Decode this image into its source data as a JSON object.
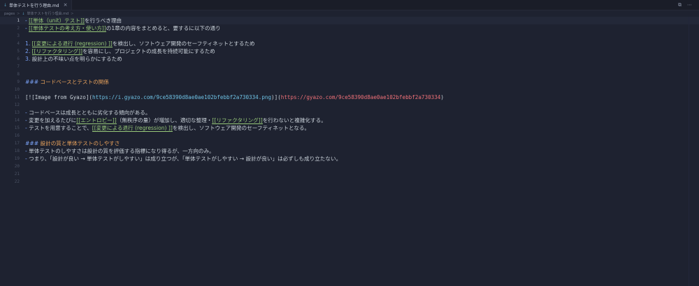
{
  "tab": {
    "icon": "markdown-icon",
    "title": "単体テストを行う理由.md",
    "close": "×"
  },
  "window_actions": {
    "split": "⧉",
    "more": "⋯"
  },
  "breadcrumb": {
    "folder": "pages",
    "sep": ">",
    "file": "単体テストを行う理由.md",
    "sep2": ">"
  },
  "lines": {
    "n1": "1",
    "n2": "2",
    "n3": "3",
    "n4": "4",
    "n5": "5",
    "n6": "6",
    "n7": "7",
    "n8": "8",
    "n9": "9",
    "n10": "10",
    "n11": "11",
    "n12": "12",
    "n13": "13",
    "n14": "14",
    "n15": "15",
    "n16": "16",
    "n17": "17",
    "n18": "18",
    "n19": "19",
    "n20": "20",
    "n21": "21",
    "n22": "22",
    "l1_bullet": "- ",
    "l1_link": "[[単体（unit）テスト]]",
    "l1_text": "を行うべき理由",
    "l2_bullet": "- ",
    "l2_link": "[[単体テストの考え方・使い方]]",
    "l2_text": "の1章の内容をまとめると、要するに以下の通り",
    "l4_num": "1. ",
    "l4_link": "[[変更による退行 (regression) ]]",
    "l4_text": "を検出し、ソフトウェア開発のセーフティネットとするため",
    "l5_num": "2. ",
    "l5_link": "[[リファクタリング]]",
    "l5_text": "を容易にし、プロジェクトの成長を持続可能にするため",
    "l6_num": "3. ",
    "l6_text": "設計上の不味い点を明らかにするため",
    "l9_mark": "### ",
    "l9_text": "コードベースとテストの関係",
    "l11_a": "[![Image from Gyazo](",
    "l11_url1": "https://i.gyazo.com/9ce58390d8ae0ae102bfebbf2a730334.png",
    "l11_b": ")](",
    "l11_url2": "https://gyazo.com/9ce58390d8ae0ae102bfebbf2a730334",
    "l11_c": ")",
    "l13_bullet": "- ",
    "l13_text": "コードベースは成長とともに劣化する傾向がある。",
    "l14_bullet": "- ",
    "l14_a": "変更を加えるたびに",
    "l14_link1": "[[エントロピー]]",
    "l14_b": "（無秩序の量）が増加し、適切な整理・",
    "l14_link2": "[[リファクタリング]]",
    "l14_c": "を行わないと複雑化する。",
    "l15_bullet": "- ",
    "l15_a": "テストを用意することで、",
    "l15_link": "[[変更による退行 (regression) ]]",
    "l15_b": "を検出し、ソフトウェア開発のセーフティネットとなる。",
    "l17_mark": "### ",
    "l17_text": "設計の質と単体テストのしやすさ",
    "l18_bullet": "- ",
    "l18_text": "単体テストのしやすさは設計の質を評価する指標になり得るが、一方向のみ。",
    "l19_bullet": "- ",
    "l19_text": "つまり、「設計が良い → 単体テストがしやすい」は成り立つが、「単体テストがしやすい → 設計が良い」は必ずしも成り立たない。"
  }
}
